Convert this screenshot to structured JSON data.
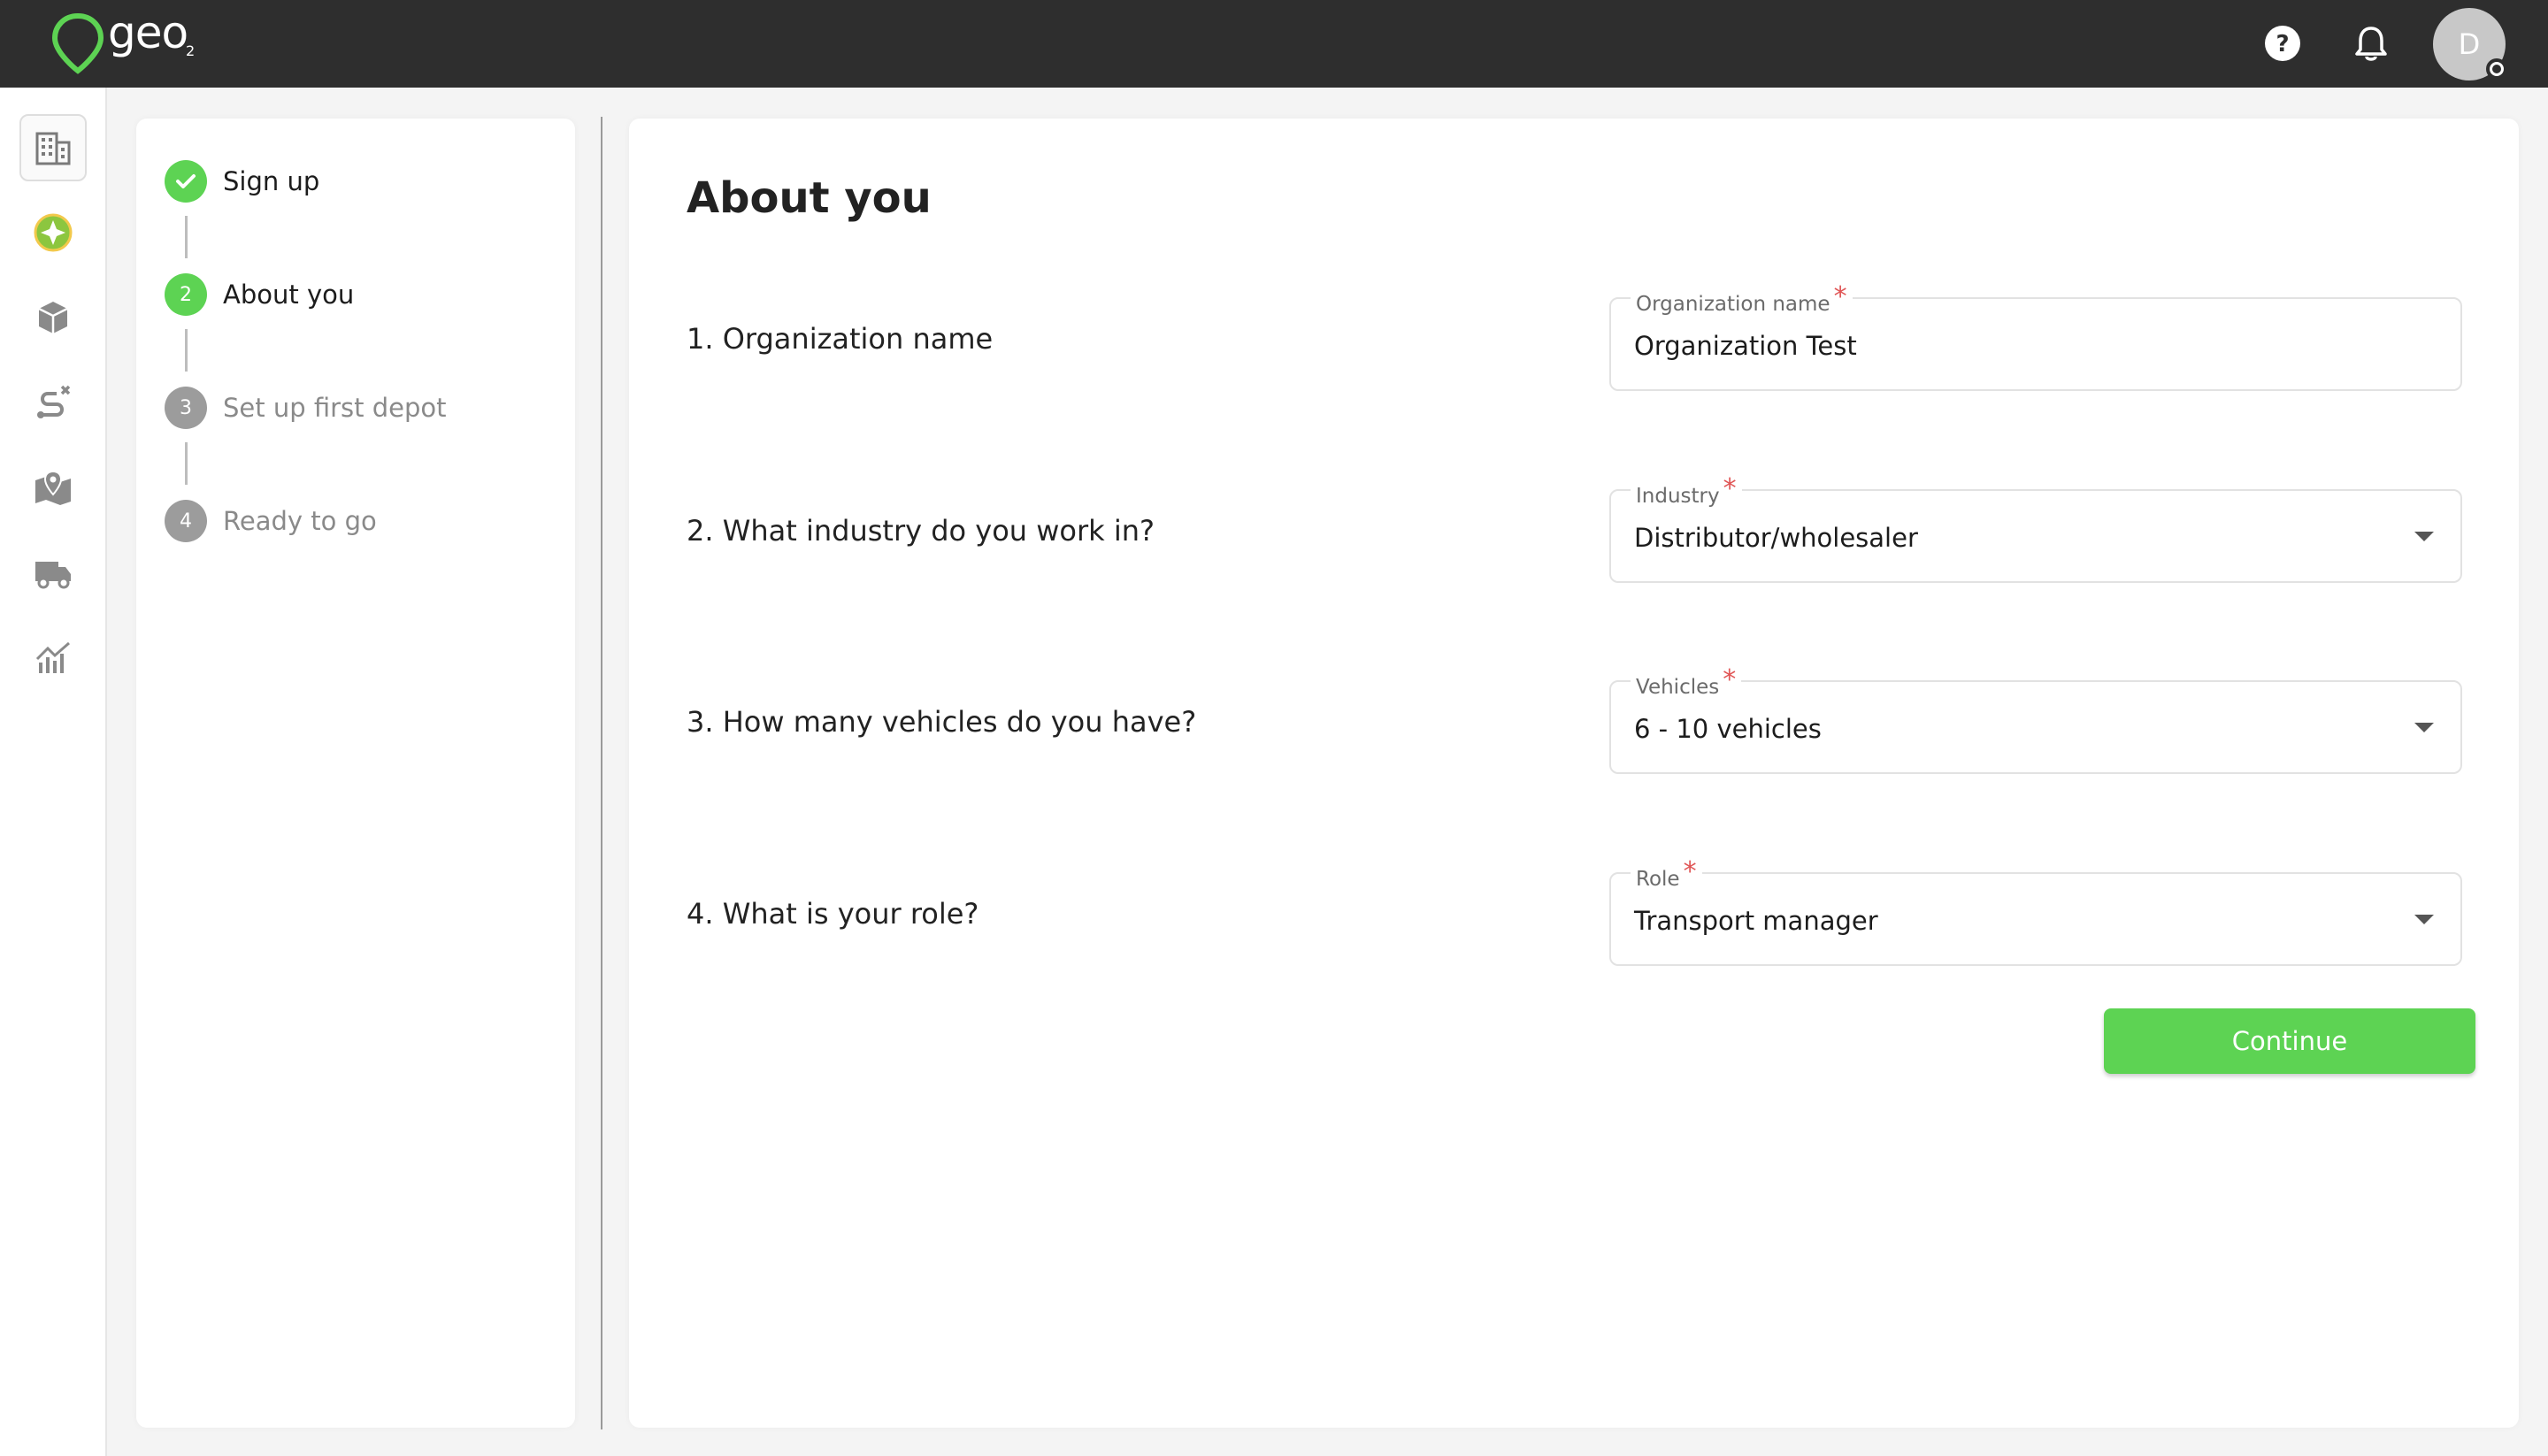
{
  "app": {
    "logo_text": "geo",
    "logo_sub": "2"
  },
  "header": {
    "avatar_initial": "D"
  },
  "steps": [
    {
      "label": "Sign up",
      "number": "",
      "state": "done"
    },
    {
      "label": "About you",
      "number": "2",
      "state": "current"
    },
    {
      "label": "Set up first depot",
      "number": "3",
      "state": "todo"
    },
    {
      "label": "Ready to go",
      "number": "4",
      "state": "todo"
    }
  ],
  "form": {
    "title": "About you",
    "questions": [
      {
        "text": "1. Organization name",
        "label": "Organization name",
        "value": "Organization Test",
        "dropdown": false
      },
      {
        "text": "2. What industry do you work in?",
        "label": "Industry",
        "value": "Distributor/wholesaler",
        "dropdown": true
      },
      {
        "text": "3. How many vehicles do you have?",
        "label": "Vehicles",
        "value": "6 - 10 vehicles",
        "dropdown": true
      },
      {
        "text": "4. What is your role?",
        "label": "Role",
        "value": "Transport manager",
        "dropdown": true
      }
    ],
    "required_mark": "*",
    "continue_label": "Continue"
  },
  "colors": {
    "accent": "#5dd353",
    "topbar": "#2e2e2e",
    "required": "#e05555"
  },
  "nav_icons": [
    "buildings-icon",
    "globe-star-icon",
    "package-icon",
    "route-icon",
    "map-pin-icon",
    "truck-icon",
    "analytics-icon"
  ]
}
